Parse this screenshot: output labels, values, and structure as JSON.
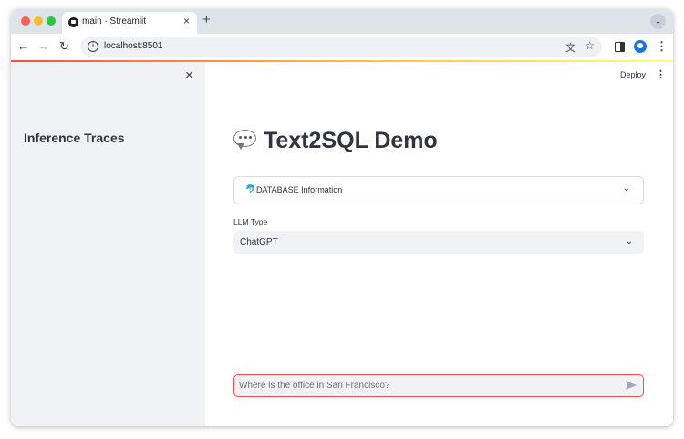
{
  "browser": {
    "tab_title": "main · Streamlit",
    "tab_close": "×",
    "new_tab": "+",
    "tab_menu": "⌄",
    "url": "localhost:8501",
    "nav_back": "←",
    "nav_forward": "→",
    "nav_reload": "↻",
    "menu": "⋮"
  },
  "sidebar": {
    "close": "×",
    "title": "Inference Traces"
  },
  "header": {
    "deploy_label": "Deploy",
    "menu": "⋮"
  },
  "main": {
    "title": "Text2SQL Demo",
    "expander": {
      "icon": "🐬",
      "label": "DATABASE Information",
      "chevron": "⌄"
    },
    "select": {
      "label": "LLM Type",
      "value": "ChatGPT",
      "chevron": "⌄"
    },
    "chat": {
      "placeholder": "Where is the office in San Francisco?"
    }
  },
  "colors": {
    "accent": "#ff4b4b",
    "sidebar_bg": "#f0f2f6",
    "text": "#31333f"
  }
}
